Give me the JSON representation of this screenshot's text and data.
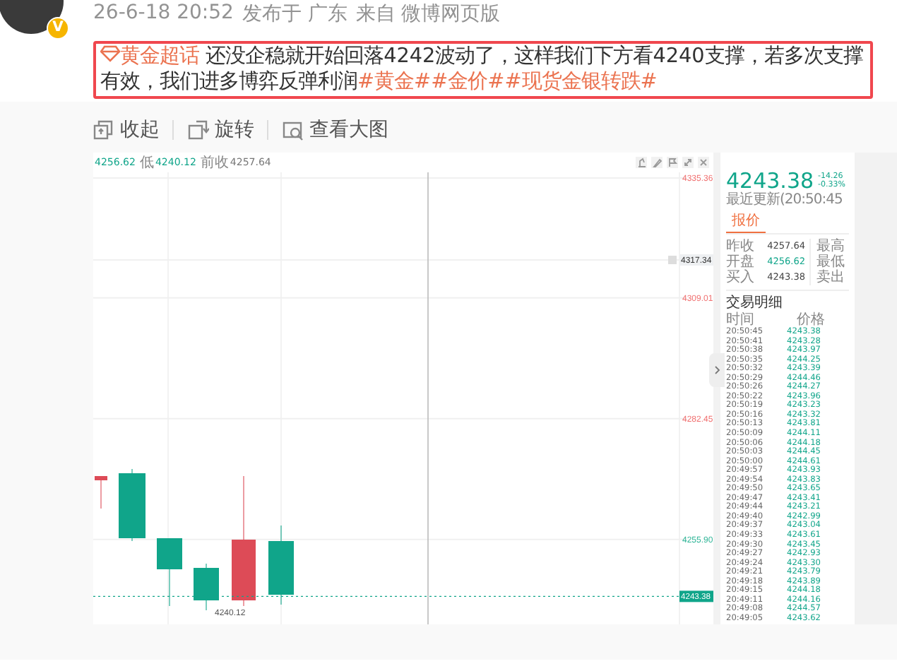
{
  "post": {
    "avatar": {
      "badge": "V"
    },
    "time": "26-6-18 20:52",
    "location": "发布于 广东",
    "source_label": "来自",
    "source": "微博网页版",
    "content": {
      "highlighted": true,
      "topic": "黄金超话",
      "text": "还没企稳就开始回落4242波动了，这样我们下方看4240支撑，若多次支撑有效，我们进多博弈反弹利润",
      "hashtags": [
        "#黄金#",
        "#金价#",
        "#现货金银转跌#"
      ]
    },
    "actions": [
      {
        "kind": "collapse",
        "label": "收起"
      },
      {
        "kind": "rotate",
        "label": "旋转"
      },
      {
        "kind": "view",
        "label": "查看大图"
      }
    ]
  },
  "chart_image": {
    "header": [
      {
        "kind": "value",
        "text": "4256.62"
      },
      {
        "kind": "label",
        "text": "低"
      },
      {
        "kind": "value",
        "text": "4240.12"
      },
      {
        "kind": "label",
        "text": "前收"
      },
      {
        "kind": "plain",
        "text": "4257.64"
      }
    ],
    "axis_labels": [
      {
        "kind": "limit",
        "text": "4335.36"
      },
      {
        "kind": "crosshair",
        "text": "4317.34"
      },
      {
        "kind": "limit",
        "text": "4309.01"
      },
      {
        "kind": "limit",
        "text": "4282.45"
      },
      {
        "kind": "level",
        "text": "4255.90"
      },
      {
        "kind": "current",
        "text": "4243.38"
      }
    ],
    "low_marker": "4240.12",
    "quote": {
      "price": "4243.38",
      "change": "-14.26",
      "change_pct": "-0.33%",
      "updated": "最近更新(20:50:45",
      "tabs": [
        {
          "label": "报价",
          "selected": true
        }
      ],
      "stats": [
        {
          "label": "昨收",
          "value": "4257.64",
          "color": "#444444",
          "side_label": "最高"
        },
        {
          "label": "开盘",
          "value": "4256.62",
          "color": "#10a58a",
          "side_label": "最低"
        },
        {
          "label": "买入",
          "value": "4243.38",
          "color": "#444444",
          "side_label": "卖出"
        }
      ],
      "trades_title": "交易明细",
      "columns": [
        "时间",
        "价格"
      ],
      "trades": [
        {
          "time": "20:50:45",
          "price": "4243.38"
        },
        {
          "time": "20:50:41",
          "price": "4243.28"
        },
        {
          "time": "20:50:38",
          "price": "4243.97"
        },
        {
          "time": "20:50:35",
          "price": "4244.25"
        },
        {
          "time": "20:50:32",
          "price": "4243.39"
        },
        {
          "time": "20:50:29",
          "price": "4244.46"
        },
        {
          "time": "20:50:26",
          "price": "4244.27"
        },
        {
          "time": "20:50:22",
          "price": "4243.96"
        },
        {
          "time": "20:50:19",
          "price": "4243.23"
        },
        {
          "time": "20:50:16",
          "price": "4243.32"
        },
        {
          "time": "20:50:13",
          "price": "4243.81"
        },
        {
          "time": "20:50:09",
          "price": "4244.11"
        },
        {
          "time": "20:50:06",
          "price": "4244.18"
        },
        {
          "time": "20:50:03",
          "price": "4244.45"
        },
        {
          "time": "20:50:00",
          "price": "4244.61"
        },
        {
          "time": "20:49:57",
          "price": "4243.93"
        },
        {
          "time": "20:49:54",
          "price": "4243.83"
        },
        {
          "time": "20:49:50",
          "price": "4243.65"
        },
        {
          "time": "20:49:47",
          "price": "4243.41"
        },
        {
          "time": "20:49:44",
          "price": "4243.21"
        },
        {
          "time": "20:49:40",
          "price": "4242.99"
        },
        {
          "time": "20:49:37",
          "price": "4243.04"
        },
        {
          "time": "20:49:33",
          "price": "4243.61"
        },
        {
          "time": "20:49:30",
          "price": "4243.45"
        },
        {
          "time": "20:49:27",
          "price": "4242.93"
        },
        {
          "time": "20:49:24",
          "price": "4243.30"
        },
        {
          "time": "20:49:21",
          "price": "4243.79"
        },
        {
          "time": "20:49:18",
          "price": "4243.89"
        },
        {
          "time": "20:49:15",
          "price": "4244.18"
        },
        {
          "time": "20:49:11",
          "price": "4244.16"
        },
        {
          "time": "20:49:08",
          "price": "4244.57"
        },
        {
          "time": "20:49:05",
          "price": "4243.62"
        }
      ]
    }
  }
}
